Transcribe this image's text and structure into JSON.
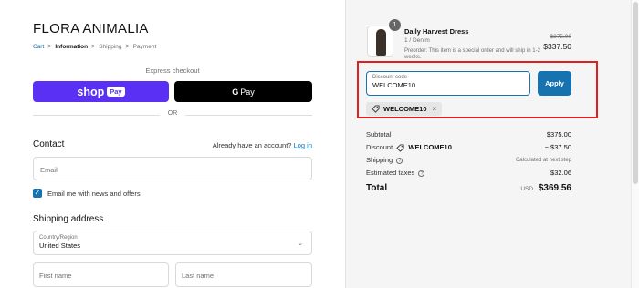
{
  "store": {
    "name": "FLORA ANIMALIA"
  },
  "breadcrumb": {
    "cart": "Cart",
    "information": "Information",
    "shipping": "Shipping",
    "payment": "Payment",
    "separator": ">"
  },
  "express": {
    "label": "Express checkout",
    "shop_pay_word": "shop",
    "shop_pay_pill": "Pay",
    "g_pay_g": "G",
    "g_pay_word": "Pay",
    "or_text": "OR"
  },
  "contact": {
    "heading": "Contact",
    "account_prompt": "Already have an account?",
    "login_link": "Log in",
    "email_placeholder": "Email",
    "newsletter_label": "Email me with news and offers",
    "newsletter_checked": true
  },
  "shipping_address": {
    "heading": "Shipping address",
    "country_label": "Country/Region",
    "country_value": "United States",
    "first_name_placeholder": "First name",
    "last_name_placeholder": "Last name"
  },
  "order": {
    "item": {
      "quantity": "1",
      "name": "Daily Harvest Dress",
      "variant": "1 / Denim",
      "note": "Preorder: This item is a special order and will ship in 1-2 weeks.",
      "compare_price": "$375.00",
      "price": "$337.50"
    },
    "discount": {
      "field_label": "Discount code",
      "field_value": "WELCOME10",
      "apply_label": "Apply",
      "applied_code": "WELCOME10",
      "remove_icon": "×"
    },
    "summary": {
      "subtotal_label": "Subtotal",
      "subtotal_value": "$375.00",
      "discount_label": "Discount",
      "discount_code": "WELCOME10",
      "discount_value": "− $37.50",
      "shipping_label": "Shipping",
      "shipping_value": "Calculated at next step",
      "taxes_label": "Estimated taxes",
      "taxes_value": "$32.06",
      "total_label": "Total",
      "total_currency": "USD",
      "total_value": "$369.56"
    }
  },
  "colors": {
    "shop_pay": "#5a31f4",
    "accent": "#1773b0",
    "highlight": "#e02020"
  }
}
